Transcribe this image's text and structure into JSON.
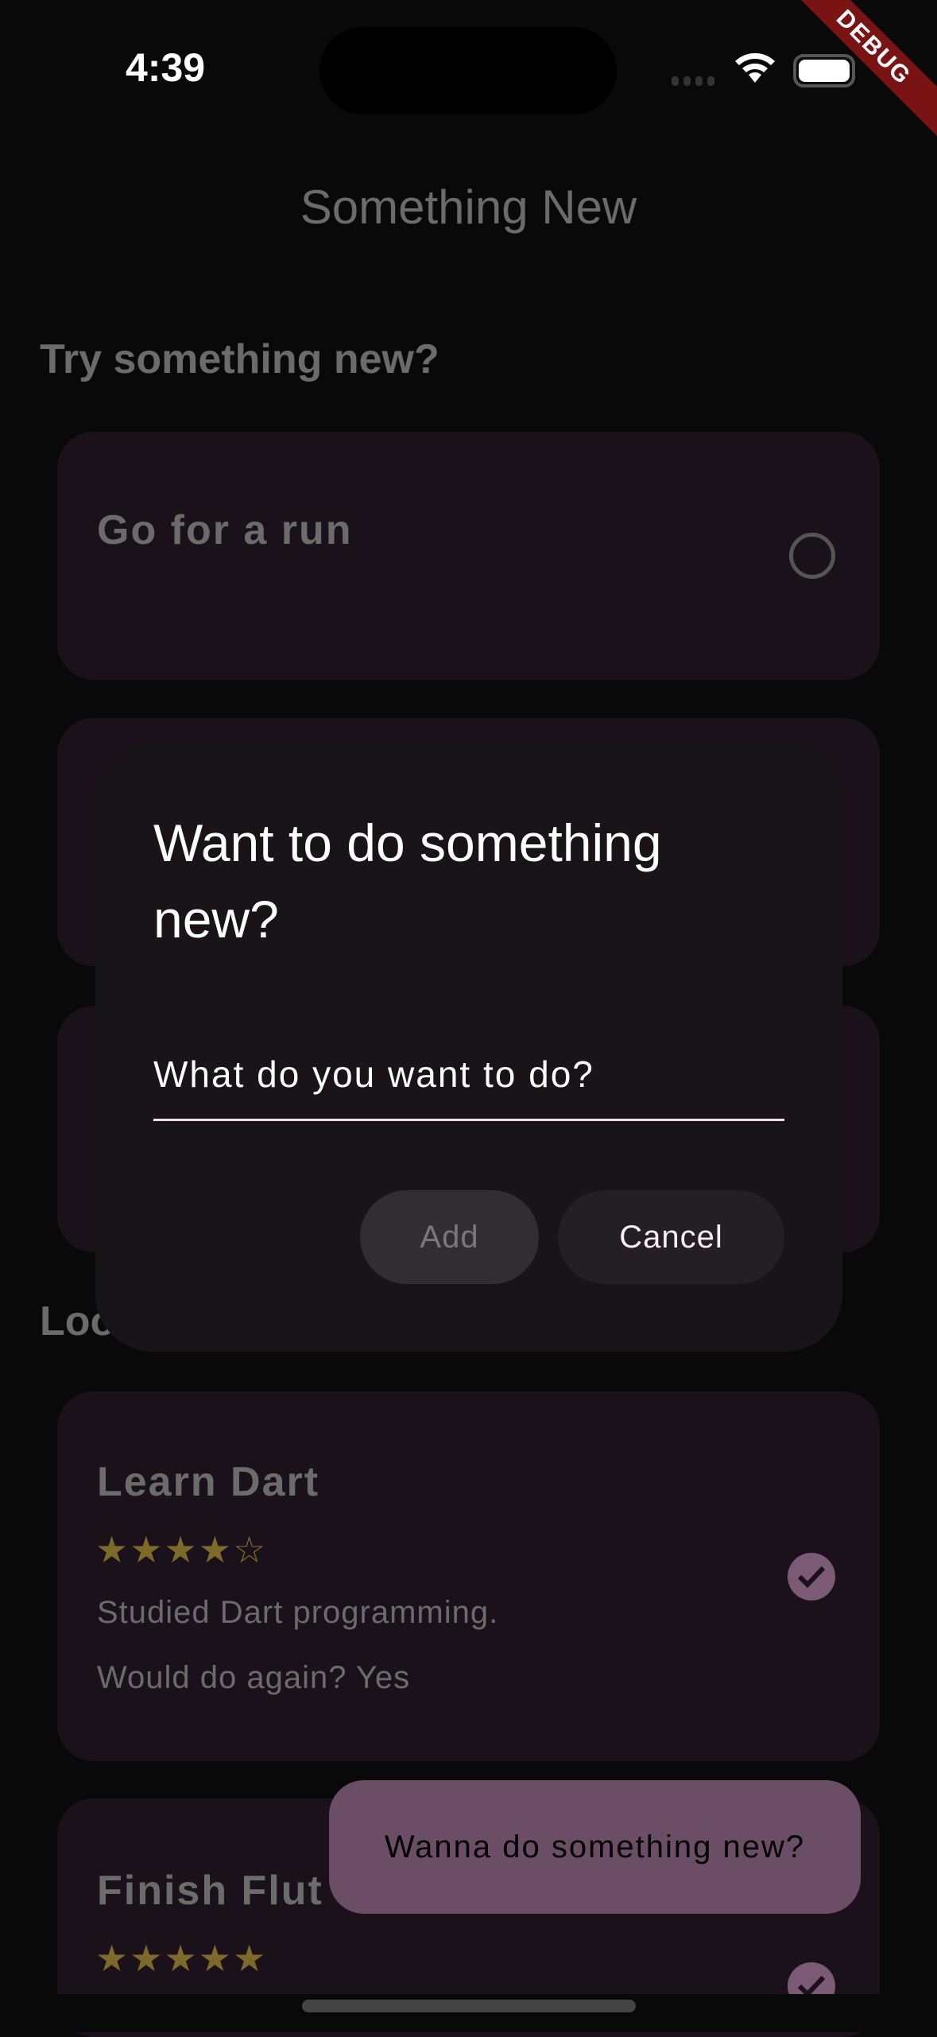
{
  "status_bar": {
    "time": "4:39",
    "debug_banner": "DEBUG"
  },
  "app_bar": {
    "title": "Something New"
  },
  "sections": {
    "try": "Try something new?",
    "log": "Loo"
  },
  "todo_items": [
    {
      "title": "Go for a run"
    }
  ],
  "done_items": [
    {
      "title": "Learn Dart",
      "stars": "★★★★☆",
      "rating": 4,
      "description": "Studied Dart programming.",
      "again": "Would do again? Yes"
    },
    {
      "title": "Finish Flut",
      "stars": "★★★★★",
      "rating": 5
    }
  ],
  "dialog": {
    "title": "Want to do something new?",
    "input_placeholder": "What do you want to do?",
    "add_label": "Add",
    "cancel_label": "Cancel"
  },
  "snackbar": {
    "message": "Wanna do something new?"
  }
}
